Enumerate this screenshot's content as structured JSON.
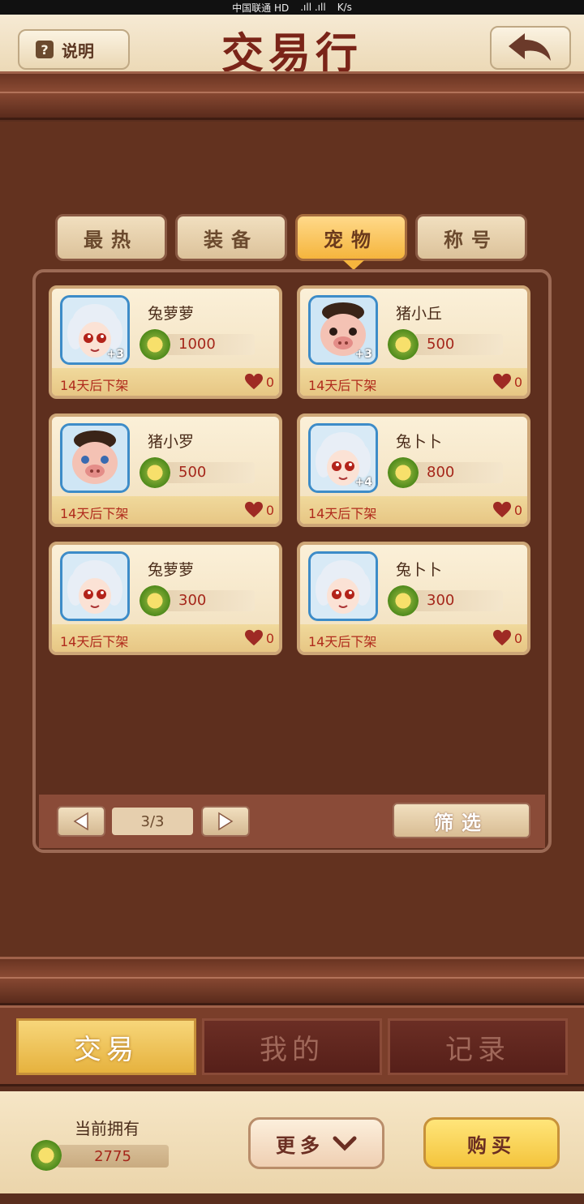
{
  "status_bar": {
    "carrier": "中国联通 HD",
    "speed": "K/s"
  },
  "header": {
    "help_label": "说明",
    "help_icon": "question-mark-icon",
    "title": "交易行",
    "back_icon": "back-arrow-icon"
  },
  "category_tabs": [
    {
      "label": "最热",
      "active": false
    },
    {
      "label": "装备",
      "active": false
    },
    {
      "label": "宠物",
      "active": true
    },
    {
      "label": "称号",
      "active": false
    }
  ],
  "items": [
    {
      "name": "兔萝萝",
      "price": "1000",
      "expiry": "14天后下架",
      "likes": "0",
      "level_badge": "+3",
      "pet_type": "rabbit"
    },
    {
      "name": "猪小丘",
      "price": "500",
      "expiry": "14天后下架",
      "likes": "0",
      "level_badge": "+3",
      "pet_type": "pig"
    },
    {
      "name": "猪小罗",
      "price": "500",
      "expiry": "14天后下架",
      "likes": "0",
      "level_badge": "",
      "pet_type": "pig"
    },
    {
      "name": "兔卜卜",
      "price": "800",
      "expiry": "14天后下架",
      "likes": "0",
      "level_badge": "+4",
      "pet_type": "rabbit"
    },
    {
      "name": "兔萝萝",
      "price": "300",
      "expiry": "14天后下架",
      "likes": "0",
      "level_badge": "",
      "pet_type": "rabbit"
    },
    {
      "name": "兔卜卜",
      "price": "300",
      "expiry": "14天后下架",
      "likes": "0",
      "level_badge": "",
      "pet_type": "rabbit"
    }
  ],
  "pager": {
    "page": "3/3",
    "filter_label": "筛选"
  },
  "mode_tabs": [
    {
      "label": "交易",
      "active": true
    },
    {
      "label": "我的",
      "active": false
    },
    {
      "label": "记录",
      "active": false
    }
  ],
  "wallet": {
    "label": "当前拥有",
    "amount": "2775"
  },
  "actions": {
    "more_label": "更多",
    "buy_label": "购买"
  },
  "colors": {
    "accent_gold": "#f5b53d",
    "price_red": "#a5261a",
    "panel_brown": "#5e2f1e"
  }
}
